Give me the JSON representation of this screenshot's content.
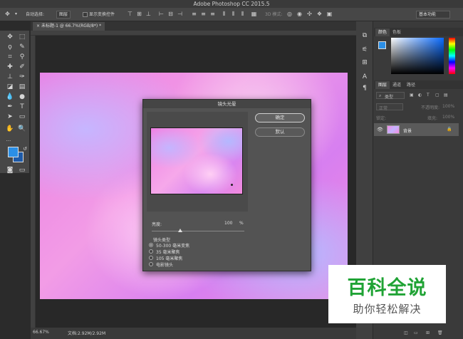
{
  "window": {
    "title": "Adobe Photoshop CC 2015.5"
  },
  "options_bar": {
    "move_icon": "move-icon",
    "auto_select_label": "自动选择:",
    "auto_select_value": "图层",
    "show_transform_label": "显示变换控件",
    "mode_3d_label": "3D 模式:",
    "workspace": "基本功能"
  },
  "document": {
    "tab_title": "未标题-1 @ 66.7%(RGB/8*) *",
    "zoom": "66.67%",
    "doc_info": "文档:2.92M/2.92M"
  },
  "panels": {
    "color_tabs": [
      "颜色",
      "色板"
    ],
    "layers_tabs": [
      "图层",
      "通道",
      "路径"
    ],
    "layer_filter": "类型",
    "blend_mode": "正常",
    "opacity_label": "不透明度:",
    "opacity_value": "100%",
    "lock_label": "锁定:",
    "fill_label": "填充:",
    "fill_value": "100%",
    "layer_name": "背景",
    "accent_color": "#2b8fe6"
  },
  "dialog": {
    "title": "镜头光晕",
    "ok_label": "确定",
    "reset_label": "默认",
    "brightness_label": "亮度:",
    "brightness_value": "100",
    "brightness_unit": "%",
    "brightness_level": 100,
    "lens_type_label": "镜头类型",
    "lens_options": [
      "50-300 毫米变焦",
      "35 毫米聚焦",
      "105 毫米聚焦",
      "电影镜头"
    ],
    "selected_lens": "50-300 毫米变焦"
  },
  "watermark": {
    "line1": "百科全说",
    "line2": "助你轻松解决"
  }
}
